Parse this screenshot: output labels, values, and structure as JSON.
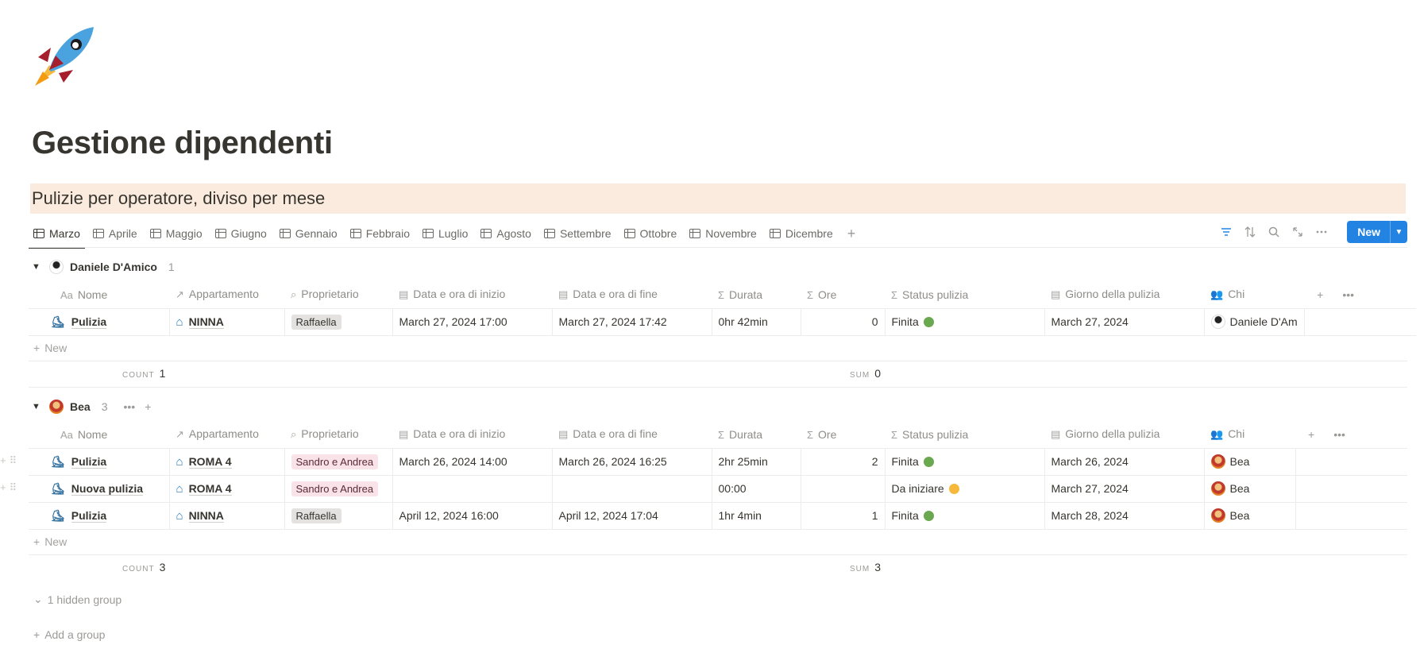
{
  "page": {
    "title": "Gestione dipendenti",
    "callout": "Pulizie per operatore, diviso per mese"
  },
  "tabs": [
    {
      "label": "Marzo"
    },
    {
      "label": "Aprile"
    },
    {
      "label": "Maggio"
    },
    {
      "label": "Giugno"
    },
    {
      "label": "Gennaio"
    },
    {
      "label": "Febbraio"
    },
    {
      "label": "Luglio"
    },
    {
      "label": "Agosto"
    },
    {
      "label": "Settembre"
    },
    {
      "label": "Ottobre"
    },
    {
      "label": "Novembre"
    },
    {
      "label": "Dicembre"
    }
  ],
  "toolbar": {
    "new_label": "New"
  },
  "columns": {
    "nome": "Nome",
    "appartamento": "Appartamento",
    "proprietario": "Proprietario",
    "inizio": "Data e ora di inizio",
    "fine": "Data e ora di fine",
    "durata": "Durata",
    "ore": "Ore",
    "status": "Status pulizia",
    "giorno": "Giorno della pulizia",
    "chi": "Chi",
    "nome_prefix": "Aa"
  },
  "groups": [
    {
      "name": "Daniele D'Amico",
      "count": "1",
      "rows": [
        {
          "nome": "Pulizia",
          "appartamento": "NINNA",
          "proprietario": "Raffaella",
          "inizio": "March 27, 2024 17:00",
          "fine": "March 27, 2024 17:42",
          "durata": "0hr 42min",
          "ore": "0",
          "status": "Finita",
          "giorno": "March 27, 2024",
          "chi": "Daniele D'Am"
        }
      ],
      "new_label": "New",
      "count_label": "COUNT",
      "count_value": "1",
      "sum_label": "SUM",
      "sum_value": "0"
    },
    {
      "name": "Bea",
      "count": "3",
      "rows": [
        {
          "nome": "Pulizia",
          "appartamento": "ROMA 4",
          "proprietario": "Sandro e Andrea",
          "inizio": "March 26, 2024 14:00",
          "fine": "March 26, 2024 16:25",
          "durata": "2hr 25min",
          "ore": "2",
          "status": "Finita",
          "giorno": "March 26, 2024",
          "chi": "Bea"
        },
        {
          "nome": "Nuova pulizia",
          "appartamento": "ROMA 4",
          "proprietario": "Sandro e Andrea",
          "inizio": "",
          "fine": "",
          "durata": "00:00",
          "ore": "",
          "status": "Da iniziare",
          "giorno": "March 27, 2024",
          "chi": "Bea"
        },
        {
          "nome": "Pulizia",
          "appartamento": "NINNA",
          "proprietario": "Raffaella",
          "inizio": "April 12, 2024 16:00",
          "fine": "April 12, 2024 17:04",
          "durata": "1hr 4min",
          "ore": "1",
          "status": "Finita",
          "giorno": "March 28, 2024",
          "chi": "Bea"
        }
      ],
      "new_label": "New",
      "count_label": "COUNT",
      "count_value": "3",
      "sum_label": "SUM",
      "sum_value": "3"
    }
  ],
  "footer": {
    "hidden_group": "1 hidden group",
    "add_group": "Add a group"
  },
  "colors": {
    "accent": "#2383e2",
    "callout_bg": "#fbeade",
    "status_done": "#6aa84f",
    "status_todo": "#f6b93b"
  }
}
